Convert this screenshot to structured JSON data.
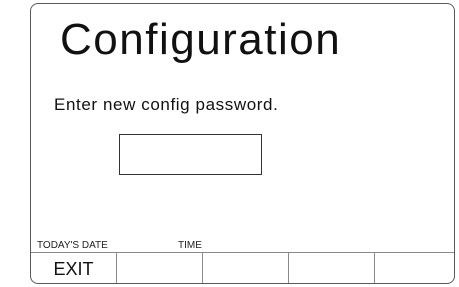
{
  "screen": {
    "title": "Configuration",
    "prompt": "Enter new config password.",
    "password_value": ""
  },
  "status": {
    "date_label": "TODAY'S DATE",
    "time_label": "TIME"
  },
  "softkeys": [
    {
      "label": "EXIT"
    },
    {
      "label": ""
    },
    {
      "label": ""
    },
    {
      "label": ""
    },
    {
      "label": ""
    }
  ]
}
